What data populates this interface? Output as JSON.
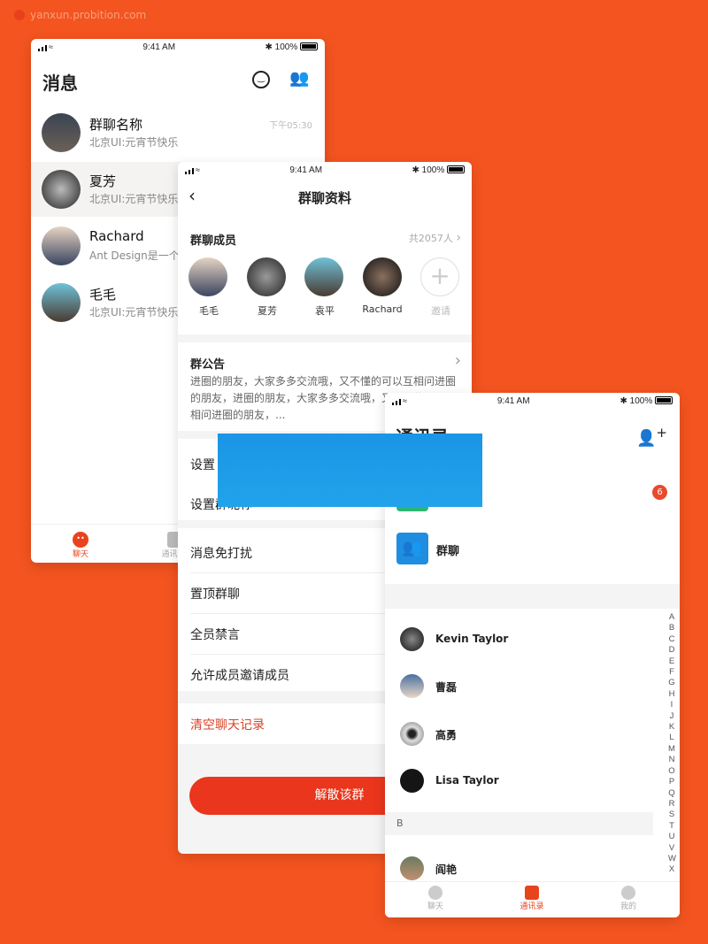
{
  "watermark": "yanxun.probition.com",
  "colors": {
    "background": "#f4541f",
    "accent": "#e9431d",
    "badge": "#e84a2e",
    "blue_overlay": "#1e9be8"
  },
  "status_bar": {
    "time": "9:41 AM",
    "battery": "100%"
  },
  "messages_screen": {
    "title": "消息",
    "icons": [
      "smile-icon",
      "contacts-icon"
    ],
    "chats": [
      {
        "name": "群聊名称",
        "preview": "北京UI:元宵节快乐",
        "time": "下午05:30"
      },
      {
        "name": "夏芳",
        "preview": "北京UI:元宵节快乐",
        "time": ""
      },
      {
        "name": "Rachard",
        "preview": "Ant Design是一个",
        "time": ""
      },
      {
        "name": "毛毛",
        "preview": "北京UI:元宵节快乐",
        "time": ""
      }
    ],
    "tabs": [
      {
        "label": "聊天",
        "active": true
      },
      {
        "label": "通讯录",
        "active": false
      }
    ]
  },
  "group_info_screen": {
    "title": "群聊资料",
    "members_label": "群聊成员",
    "members_count": "共2057人",
    "members": [
      "毛毛",
      "夏芳",
      "袁平",
      "Rachard"
    ],
    "invite_label": "邀请",
    "notice_title": "群公告",
    "notice_text": "进圈的朋友，大家多多交流哦，又不懂的可以互相问进圈的朋友，进圈的朋友，大家多多交流哦，又不懂的可以互相问进圈的朋友，...",
    "settings": [
      "设置",
      "设置群昵称"
    ],
    "toggles": [
      "消息免打扰",
      "置顶群聊",
      "全员禁言",
      "允许成员邀请成员"
    ],
    "clear_label": "清空聊天记录",
    "dissolve_label": "解散该群"
  },
  "contacts_screen": {
    "title": "通讯录",
    "new_friends_badge": "6",
    "group_chat_label": "群聊",
    "contacts_a": [
      "Kevin Taylor",
      "曹磊",
      "高勇",
      "Lisa Taylor"
    ],
    "section_b": "B",
    "contacts_b": [
      "阎艳"
    ],
    "index": "A B C D E F G H I J K L M N O P Q R S T U V W X",
    "tabs": [
      {
        "label": "聊天",
        "active": false
      },
      {
        "label": "通讯录",
        "active": true
      },
      {
        "label": "我的",
        "active": false
      }
    ]
  }
}
